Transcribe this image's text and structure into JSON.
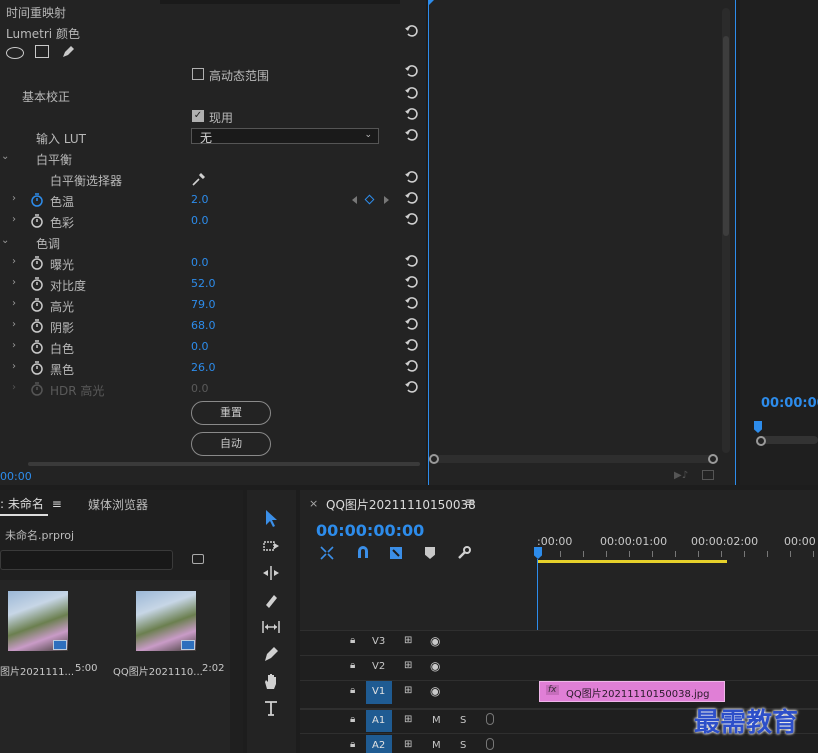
{
  "effect_controls": {
    "top_clip_partial": "时间重映射",
    "lumetri_label": "Lumetri 颜色",
    "hdr_range_label": "高动态范围",
    "basic_correction_label": "基本校正",
    "enabled_label": "现用",
    "input_lut_label": "输入 LUT",
    "input_lut_value": "无",
    "white_balance_label": "白平衡",
    "wb_selector_label": "白平衡选择器",
    "params": [
      {
        "label": "色温",
        "value": "2.0",
        "keyframed": true
      },
      {
        "label": "色彩",
        "value": "0.0",
        "keyframed": false
      }
    ],
    "tone_label": "色调",
    "tone_params": [
      {
        "label": "曝光",
        "value": "0.0"
      },
      {
        "label": "对比度",
        "value": "52.0"
      },
      {
        "label": "高光",
        "value": "79.0"
      },
      {
        "label": "阴影",
        "value": "68.0"
      },
      {
        "label": "白色",
        "value": "0.0"
      },
      {
        "label": "黑色",
        "value": "26.0"
      },
      {
        "label": "HDR 高光",
        "value": "0.0",
        "disabled": true
      }
    ],
    "reset_button": "重置",
    "auto_button": "自动",
    "timecode": "00:00"
  },
  "program": {
    "timecode": "00:00:00"
  },
  "project": {
    "tab_project": ": 未命名",
    "tab_media": "媒体浏览器",
    "project_file": "未命名.prproj",
    "items": [
      {
        "name": "图片2021111...",
        "duration": "5:00"
      },
      {
        "name": "QQ图片2021110...",
        "duration": "2:02"
      }
    ]
  },
  "timeline": {
    "sequence_name": "QQ图片20211110150038",
    "timecode": "00:00:00:00",
    "ruler": [
      ":00:00",
      "00:00:01:00",
      "00:00:02:00",
      "00:00"
    ],
    "tracks": [
      {
        "name": "V3",
        "type": "video"
      },
      {
        "name": "V2",
        "type": "video"
      },
      {
        "name": "V1",
        "type": "video",
        "active": true
      },
      {
        "name": "A1",
        "type": "audio",
        "active": true
      },
      {
        "name": "A2",
        "type": "audio",
        "active": true
      }
    ],
    "clip_label": "QQ图片20211110150038.jpg",
    "clip_fx": "fx",
    "mute": "M",
    "solo": "S"
  },
  "watermark": "最需教育",
  "colors": {
    "accent": "#2d8ceb",
    "clip": "#e07fd6",
    "work_area": "#e6d12b"
  }
}
